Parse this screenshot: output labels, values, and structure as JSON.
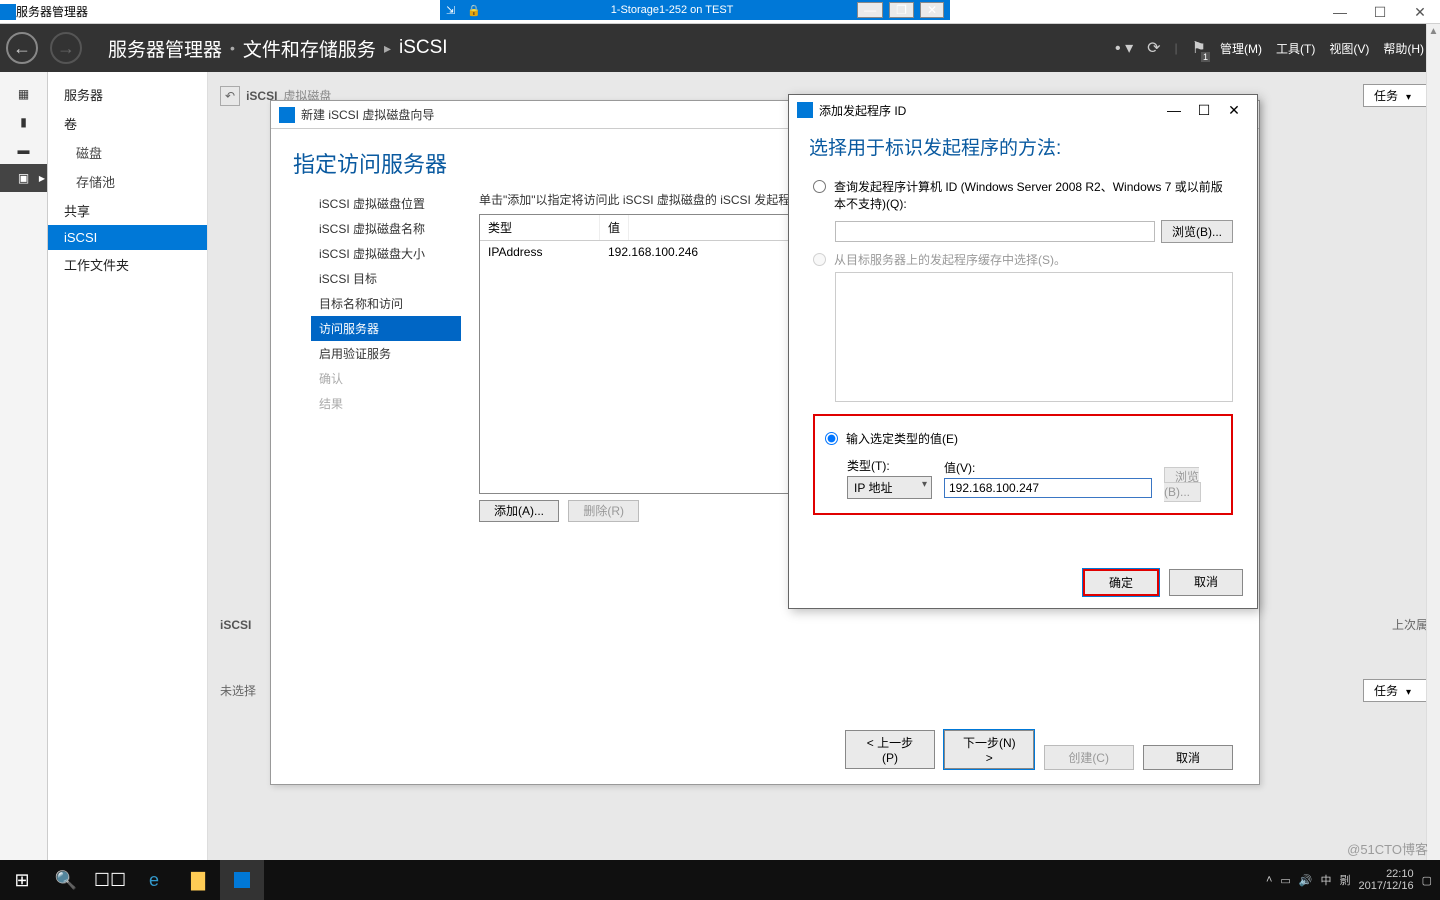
{
  "app": {
    "title": "服务器管理器"
  },
  "remote": {
    "title": "1-Storage1-252 on TEST",
    "pin": "⇲",
    "lock": "🔒"
  },
  "win_controls": {
    "min": "—",
    "max": "☐",
    "close": "✕"
  },
  "header": {
    "breadcrumb": [
      "服务器管理器",
      "文件和存储服务",
      "iSCSI"
    ],
    "menu": {
      "manage": "管理(M)",
      "tools": "工具(T)",
      "view": "视图(V)",
      "help": "帮助(H)"
    },
    "flag_badge": "1"
  },
  "nav": {
    "items": [
      {
        "label": "服务器",
        "sub": false
      },
      {
        "label": "卷",
        "sub": false
      },
      {
        "label": "磁盘",
        "sub": true
      },
      {
        "label": "存储池",
        "sub": true
      },
      {
        "label": "共享",
        "sub": false
      },
      {
        "label": "iSCSI",
        "sub": false,
        "active": true
      },
      {
        "label": "工作文件夹",
        "sub": false
      }
    ]
  },
  "section1": {
    "title": "iSCSI",
    "subtitle": "虚拟磁盘",
    "tasks": "任务"
  },
  "section2": {
    "title": "iSCSI",
    "subtitle_a": "未选择",
    "subtitle_b": "上次属"
  },
  "wizard": {
    "window_title": "新建 iSCSI 虚拟磁盘向导",
    "heading": "指定访问服务器",
    "steps": [
      "iSCSI 虚拟磁盘位置",
      "iSCSI 虚拟磁盘名称",
      "iSCSI 虚拟磁盘大小",
      "iSCSI 目标",
      "目标名称和访问",
      "访问服务器",
      "启用验证服务",
      "确认",
      "结果"
    ],
    "active_step_index": 5,
    "disabled_from": 7,
    "hint": "单击\"添加\"以指定将访问此 iSCSI 虚拟磁盘的 iSCSI 发起程序",
    "table": {
      "headers": [
        "类型",
        "值"
      ],
      "rows": [
        [
          "IPAddress",
          "192.168.100.246"
        ]
      ]
    },
    "buttons": {
      "add": "添加(A)...",
      "remove": "删除(R)"
    },
    "footer": {
      "prev": "< 上一步(P)",
      "next": "下一步(N) >",
      "create": "创建(C)",
      "cancel": "取消"
    }
  },
  "dialog": {
    "title": "添加发起程序 ID",
    "heading": "选择用于标识发起程序的方法:",
    "opt1": "查询发起程序计算机 ID (Windows Server 2008 R2、Windows 7 或以前版本不支持)(Q):",
    "browse1": "浏览(B)...",
    "opt2": "从目标服务器上的发起程序缓存中选择(S)。",
    "opt3": "输入选定类型的值(E)",
    "type_label": "类型(T):",
    "value_label": "值(V):",
    "type_selected": "IP 地址",
    "value_input": "192.168.100.247",
    "browse2": "浏览(B)...",
    "ok": "确定",
    "cancel": "取消"
  },
  "taskbar": {
    "tray": {
      "ime": "中",
      "time": "22:10",
      "date": "2017/12/16"
    }
  },
  "watermark": "@51CTO博客"
}
